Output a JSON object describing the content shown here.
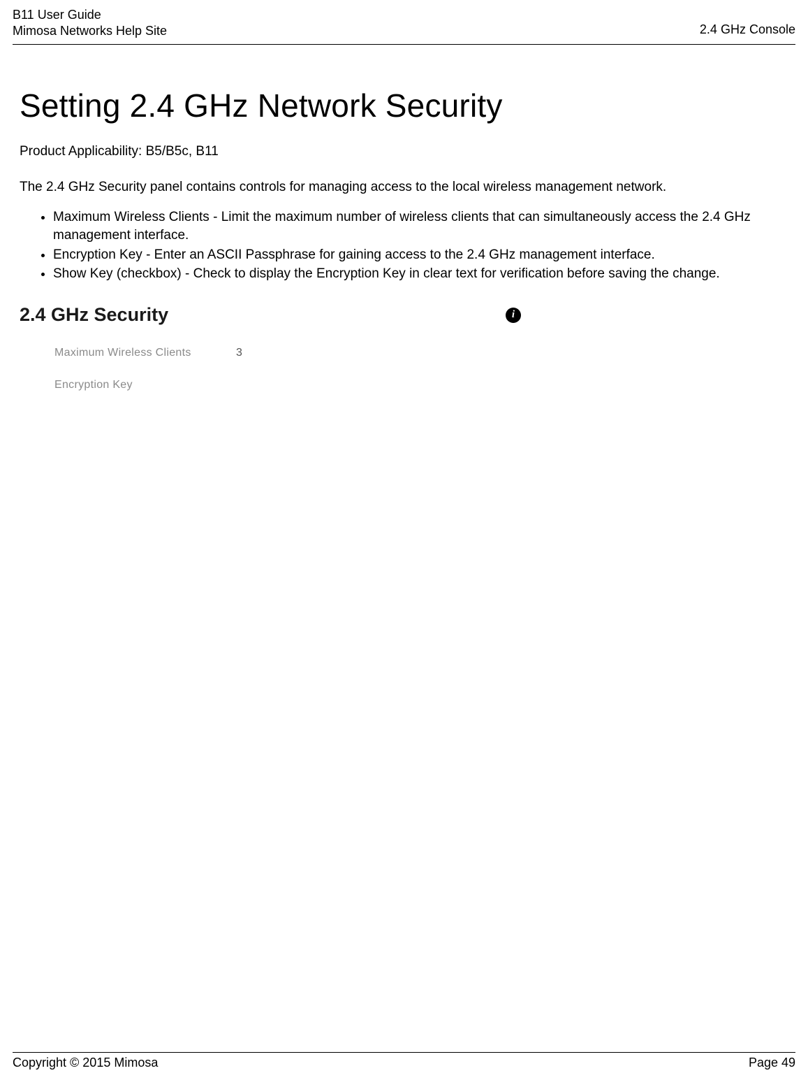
{
  "header": {
    "guide_title": "B11 User Guide",
    "help_site": "Mimosa Networks Help Site",
    "section": "2.4 GHz Console"
  },
  "main": {
    "title": "Setting 2.4 GHz Network Security",
    "applicability": "Product Applicability: B5/B5c, B11",
    "description": "The 2.4 GHz Security panel contains controls for managing access to the local wireless management network.",
    "bullets": [
      "Maximum Wireless Clients - Limit the maximum number of wireless clients that can simultaneously access the 2.4 GHz management interface.",
      "Encryption Key - Enter an ASCII Passphrase for gaining access to the 2.4 GHz management interface.",
      "Show Key (checkbox) - Check to display the Encryption Key in clear text for verification before saving the change."
    ]
  },
  "panel": {
    "title": "2.4 GHz Security",
    "info_icon": "i",
    "rows": [
      {
        "label": "Maximum Wireless Clients",
        "value": "3"
      },
      {
        "label": "Encryption Key",
        "value": ""
      }
    ]
  },
  "footer": {
    "copyright": "Copyright © 2015 Mimosa",
    "page": "Page 49"
  }
}
